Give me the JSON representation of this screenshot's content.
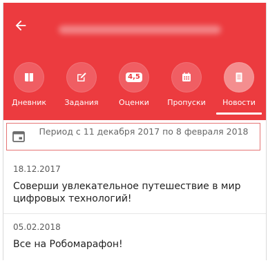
{
  "header": {
    "tabs": [
      {
        "label": "Дневник",
        "icon": "diary-icon"
      },
      {
        "label": "Задания",
        "icon": "edit-task-icon"
      },
      {
        "label": "Оценки",
        "icon": "grades-icon",
        "badge": "4,5"
      },
      {
        "label": "Пропуски",
        "icon": "calendar-icon"
      },
      {
        "label": "Новости",
        "icon": "news-icon",
        "active": true
      }
    ]
  },
  "period": {
    "text": "Период с 11 декабря 2017 по 8 февраля 2018"
  },
  "news": [
    {
      "date": "18.12.2017",
      "text": "Соверши увлекательное путешествие в мир цифровых технологий!"
    },
    {
      "date": "05.02.2018",
      "text": "Все на Робомарафон!"
    }
  ],
  "colors": {
    "primary": "#ec3b3f",
    "accent_border": "#e57373"
  }
}
